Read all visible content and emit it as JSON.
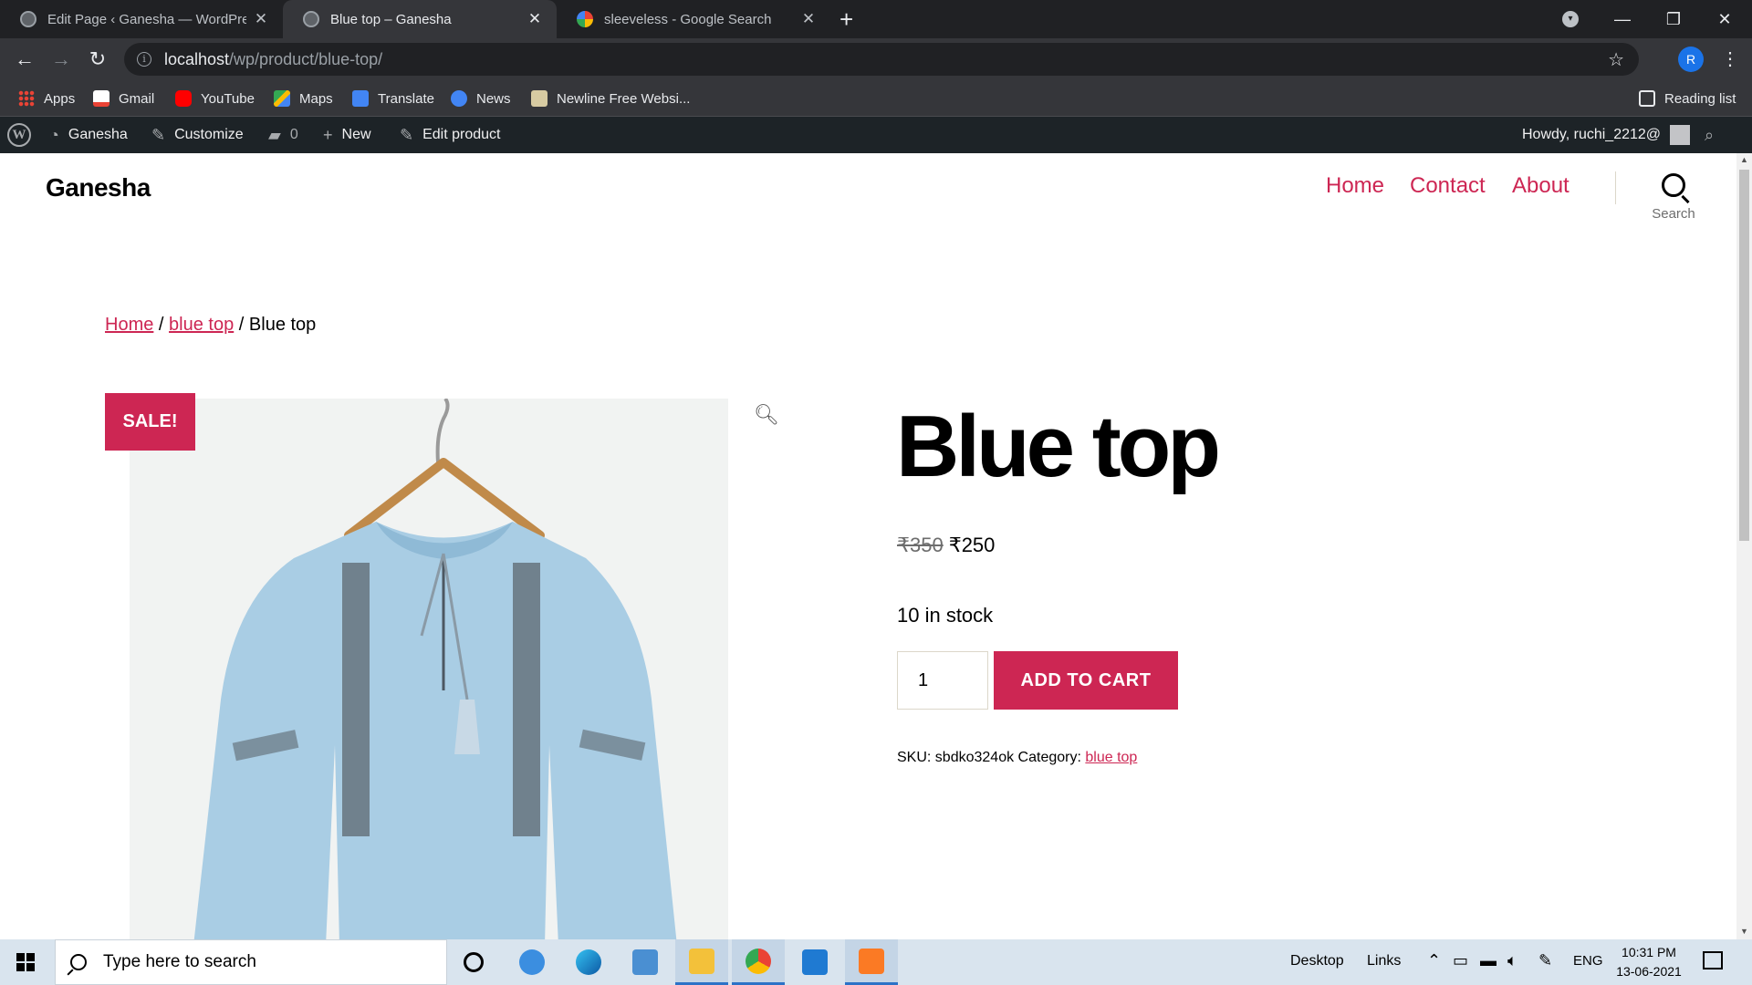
{
  "browser": {
    "tabs": [
      {
        "title": "Edit Page ‹ Ganesha — WordPress",
        "active": false,
        "favicon": "wordpress-icon"
      },
      {
        "title": "Blue top – Ganesha",
        "active": true,
        "favicon": "wordpress-icon"
      },
      {
        "title": "sleeveless - Google Search",
        "active": false,
        "favicon": "google-icon"
      }
    ],
    "new_tab_glyph": "+",
    "url_host": "localhost",
    "url_path": "/wp/product/blue-top/",
    "profile_initial": "R",
    "bookmarks": [
      {
        "label": "Apps",
        "icon": "apps-icon"
      },
      {
        "label": "Gmail",
        "icon": "gmail-icon"
      },
      {
        "label": "YouTube",
        "icon": "youtube-icon"
      },
      {
        "label": "Maps",
        "icon": "maps-icon"
      },
      {
        "label": "Translate",
        "icon": "translate-icon"
      },
      {
        "label": "News",
        "icon": "news-icon"
      },
      {
        "label": "Newline Free Websi...",
        "icon": "newline-icon"
      }
    ],
    "reading_list": "Reading list"
  },
  "wp_admin_bar": {
    "site_name": "Ganesha",
    "customize": "Customize",
    "comments_count": "0",
    "new_label": "New",
    "edit_label": "Edit product",
    "howdy": "Howdy, ruchi_2212@"
  },
  "site": {
    "title": "Ganesha",
    "nav": [
      "Home",
      "Contact",
      "About"
    ],
    "search_label": "Search",
    "accent_color": "#cd2653"
  },
  "breadcrumb": {
    "home": "Home",
    "category": "blue top",
    "current": "Blue top",
    "separator": "/"
  },
  "product": {
    "sale_badge": "SALE!",
    "title": "Blue top",
    "old_price": "₹350",
    "price": "₹250",
    "stock": "10 in stock",
    "quantity": "1",
    "add_to_cart": "ADD TO CART",
    "sku_label": "SKU:",
    "sku": "sbdko324ok",
    "category_label": "Category:",
    "category": "blue top"
  },
  "taskbar": {
    "search_placeholder": "Type here to search",
    "desktop": "Desktop",
    "links": "Links",
    "language": "ENG",
    "time": "10:31 PM",
    "date": "13-06-2021"
  }
}
